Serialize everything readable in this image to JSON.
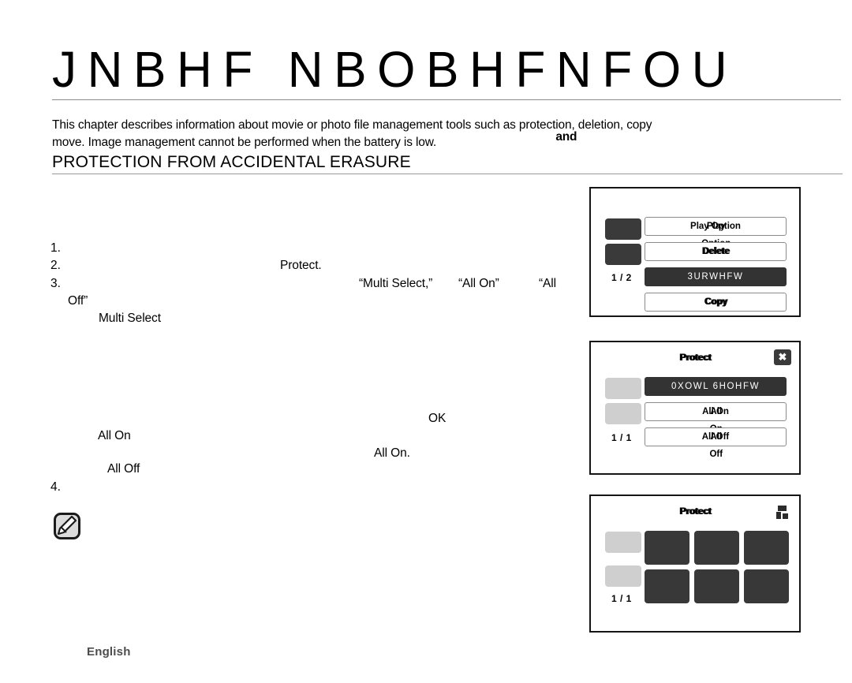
{
  "document": {
    "chapter_title": "JNBHF NBOBHFNFOU",
    "intro_line1_a": "This chapter describes information about movie or photo file management tools such as protection, deletion, copy",
    "intro_overlap_word": "and",
    "intro_line2": "move. Image management cannot be performed when the battery is low.",
    "section_heading": "PROTECTION FROM ACCIDENTAL ERASURE",
    "footer_language": "English"
  },
  "steps": {
    "n1": "1.",
    "n2": "2.",
    "n3": "3.",
    "n4": "4.",
    "frag_protect": "Protect.",
    "frag_multi_select_q": "“Multi Select,”",
    "frag_all_on_q": "“All On”",
    "frag_all_q": "“All",
    "frag_off_q": "Off”",
    "frag_multi_select": "Multi Select",
    "frag_ok": "OK",
    "frag_all_on": "All On",
    "frag_all_on_period": "All On.",
    "frag_all_off": "All Off"
  },
  "panels": [
    {
      "name": "play-option-menu",
      "page_indicator": "1 / 2",
      "title": "",
      "rows": [
        {
          "label": "Play Option",
          "selected": false
        },
        {
          "label": "Delete",
          "selected": false
        },
        {
          "label": "3URWHFW",
          "selected": true
        },
        {
          "label": "Copy",
          "selected": false
        }
      ],
      "side_boxes": [
        "dark",
        "dark"
      ]
    },
    {
      "name": "protect-menu",
      "page_indicator": "1 / 1",
      "title": "Protect",
      "close_label": "✖",
      "rows": [
        {
          "label": "0XOWL 6HOHFW",
          "selected": true
        },
        {
          "label": "All On",
          "selected": false
        },
        {
          "label": "All Off",
          "selected": false
        }
      ],
      "side_boxes": [
        "light",
        "light"
      ]
    },
    {
      "name": "protect-thumbnail-grid",
      "page_indicator": "1 / 1",
      "title": "Protect",
      "side_boxes": [
        "light",
        "light"
      ],
      "thumbnail_count": 6
    }
  ],
  "icons": {
    "note": "note-pencil-icon",
    "close": "close-icon",
    "ok": "ok-button-icon"
  }
}
